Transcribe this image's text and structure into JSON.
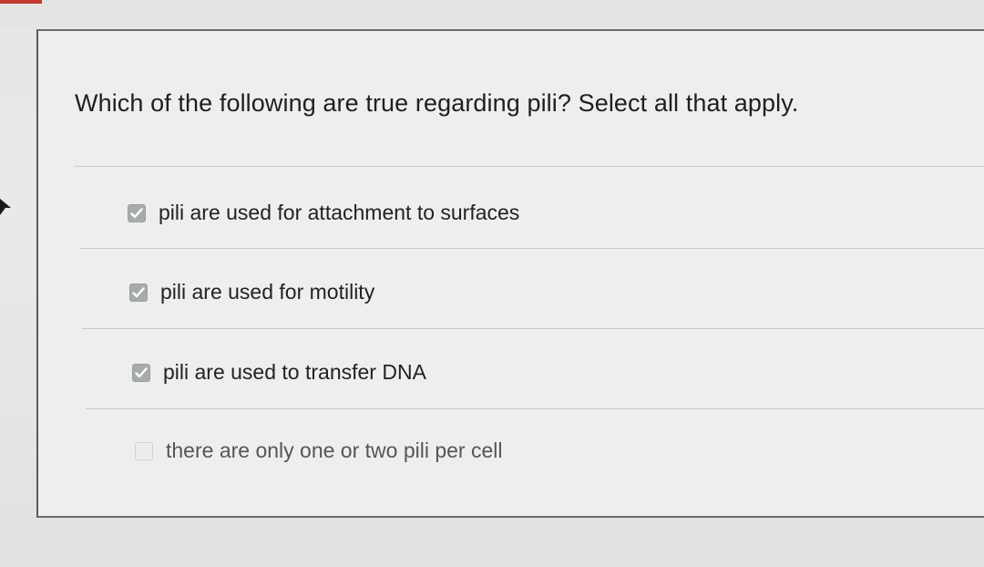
{
  "question": {
    "prompt": "Which of the following are true regarding pili? Select all that apply."
  },
  "options": [
    {
      "label": "pili are used for attachment to surfaces",
      "checked": true
    },
    {
      "label": "pili are used for motility",
      "checked": true
    },
    {
      "label": "pili are used to transfer DNA",
      "checked": true
    },
    {
      "label": "there are only one or two pili per cell",
      "checked": false
    }
  ],
  "colors": {
    "accent": "#c0392b",
    "checkbox_checked": "#a7acaa",
    "text": "#222222"
  },
  "icons": {
    "checkmark": "checkmark-icon",
    "cursor": "arrow-cursor-icon"
  }
}
